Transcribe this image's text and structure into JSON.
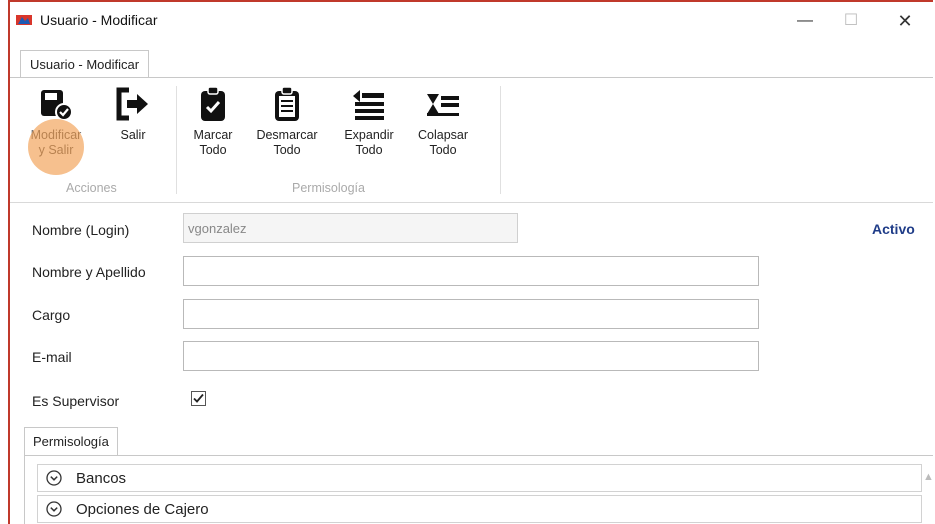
{
  "window": {
    "title": "Usuario - Modificar",
    "controls": {
      "minimize": "—",
      "maximize": "☐",
      "close": "✕"
    }
  },
  "ribbon": {
    "tab": "Usuario - Modificar",
    "groups": [
      {
        "label": "Acciones"
      },
      {
        "label": "Permisología"
      }
    ],
    "buttons": {
      "modificar_line1": "Modificar",
      "modificar_line2": "y Salir",
      "salir": "Salir",
      "marcar_line1": "Marcar",
      "marcar_line2": "Todo",
      "desmarcar_line1": "Desmarcar",
      "desmarcar_line2": "Todo",
      "expandir_line1": "Expandir",
      "expandir_line2": "Todo",
      "colapsar_line1": "Colapsar",
      "colapsar_line2": "Todo"
    }
  },
  "form": {
    "login_label": "Nombre (Login)",
    "login_value": "vgonzalez",
    "nombre_label": "Nombre y Apellido",
    "nombre_value": "",
    "cargo_label": "Cargo",
    "cargo_value": "",
    "email_label": "E-mail",
    "email_value": "",
    "supervisor_label": "Es Supervisor",
    "supervisor_checked": true,
    "status": "Activo"
  },
  "permisologia": {
    "tab": "Permisología",
    "items": [
      {
        "label": "Bancos"
      },
      {
        "label": "Opciones de Cajero"
      }
    ]
  },
  "colors": {
    "window_border": "#c0392b",
    "highlight": "#ee8c32",
    "status_text": "#1f3c88"
  }
}
